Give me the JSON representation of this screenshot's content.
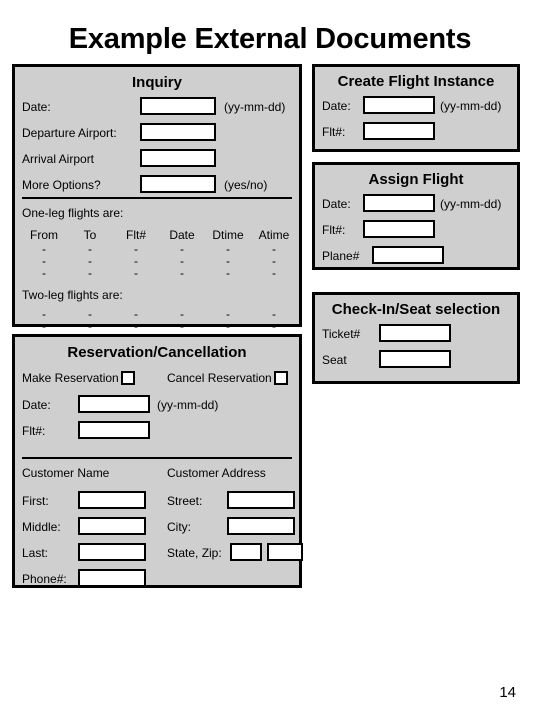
{
  "page": {
    "title": "Example External Documents",
    "number": "14"
  },
  "inquiry": {
    "title": "Inquiry",
    "date_label": "Date:",
    "date_value": "",
    "date_hint": "(yy-mm-dd)",
    "departure_label": "Departure Airport:",
    "departure_value": "",
    "arrival_label": "Arrival Airport",
    "arrival_value": "",
    "more_options_label": "More Options?",
    "more_options_value": "",
    "more_options_hint": "(yes/no)",
    "one_leg_label": "One-leg flights are:",
    "two_leg_label": "Two-leg flights are:",
    "columns": [
      "From",
      "To",
      "Flt#",
      "Date",
      "Dtime",
      "Atime"
    ],
    "one_leg_rows": [
      [
        "-",
        "-",
        "-",
        "-",
        "-",
        "-"
      ],
      [
        "-",
        "-",
        "-",
        "-",
        "-",
        "-"
      ],
      [
        "-",
        "-",
        "-",
        "-",
        "-",
        "-"
      ]
    ],
    "two_leg_rows": [
      [
        "-",
        "-",
        "-",
        "-",
        "-",
        "-"
      ],
      [
        "-",
        "-",
        "-",
        "-",
        "-",
        "-"
      ]
    ]
  },
  "create_flight": {
    "title": "Create Flight Instance",
    "date_label": "Date:",
    "date_value": "",
    "date_hint": "(yy-mm-dd)",
    "flt_label": "Flt#:",
    "flt_value": ""
  },
  "assign_flight": {
    "title": "Assign Flight",
    "date_label": "Date:",
    "date_value": "",
    "date_hint": "(yy-mm-dd)",
    "flt_label": "Flt#:",
    "flt_value": "",
    "plane_label": "Plane#",
    "plane_value": ""
  },
  "checkin": {
    "title": "Check-In/Seat selection",
    "ticket_label": "Ticket#",
    "ticket_value": "",
    "seat_label": "Seat",
    "seat_value": ""
  },
  "reservation": {
    "title": "Reservation/Cancellation",
    "make_label": "Make Reservation",
    "cancel_label": "Cancel Reservation",
    "date_label": "Date:",
    "date_value": "",
    "date_hint": "(yy-mm-dd)",
    "flt_label": "Flt#:",
    "flt_value": "",
    "customer_name_heading": "Customer Name",
    "customer_address_heading": "Customer Address",
    "first_label": "First:",
    "first_value": "",
    "middle_label": "Middle:",
    "middle_value": "",
    "last_label": "Last:",
    "last_value": "",
    "phone_label": "Phone#:",
    "phone_value": "",
    "street_label": "Street:",
    "street_value": "",
    "city_label": "City:",
    "city_value": "",
    "state_zip_label": "State, Zip:",
    "state_value": "",
    "zip_value": ""
  },
  "colors": {
    "panel_bg": "#cfcfcf",
    "border": "#000000",
    "field_bg": "#ffffff",
    "page_bg": "#ffffff"
  }
}
